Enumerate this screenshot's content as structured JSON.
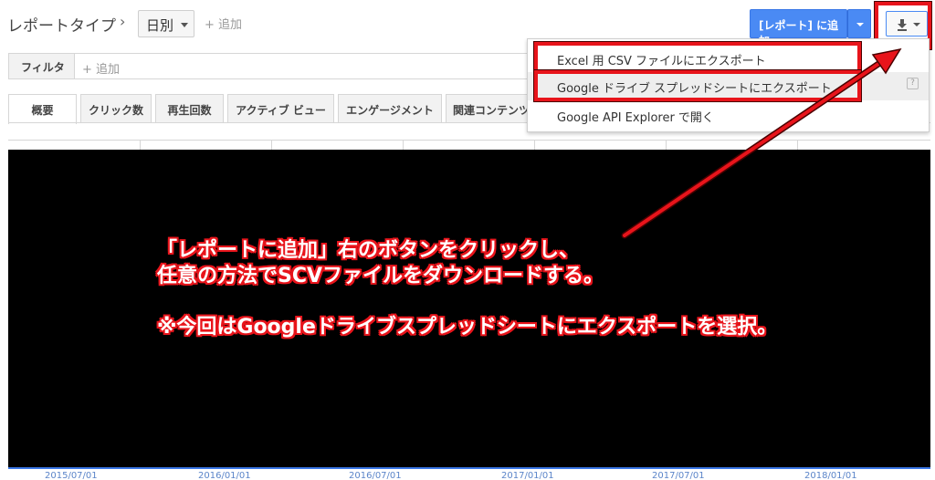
{
  "header": {
    "report_type_label": "レポートタイプ",
    "breadcrumb_chevron": "›",
    "period_value": "日別",
    "add_label": "+ 追加",
    "add_to_report_label": "[レポート] に追加"
  },
  "filter": {
    "label": "フィルタ",
    "add_label": "+ 追加"
  },
  "tabs": [
    {
      "label": "概要"
    },
    {
      "label": "クリック数"
    },
    {
      "label": "再生回数"
    },
    {
      "label": "アクティブ ビュー"
    },
    {
      "label": "エンゲージメント"
    },
    {
      "label": "関連コンテンツ"
    }
  ],
  "export_menu": {
    "items": [
      {
        "label": "Excel 用 CSV ファイルにエクスポート"
      },
      {
        "label": "Google ドライブ スプレッドシートにエクスポート"
      },
      {
        "label": "Google API Explorer で開く"
      }
    ],
    "help_label": "?"
  },
  "annotation": {
    "line1": "「レポートに追加」右のボタンをクリックし、",
    "line2": "任意の方法でSCVファイルをダウンロードする。",
    "line3": "※今回はGoogleドライブスプレッドシートにエクスポートを選択。"
  },
  "axis_labels": [
    "2015/07/01",
    "2016/01/01",
    "2016/07/01",
    "2017/01/01",
    "2017/07/01",
    "2018/01/01"
  ],
  "colors": {
    "accent_blue": "#4a8af4",
    "highlight_red": "#e8141b"
  },
  "icons": {
    "download": "download-icon",
    "caret": "chevron-down-icon"
  }
}
